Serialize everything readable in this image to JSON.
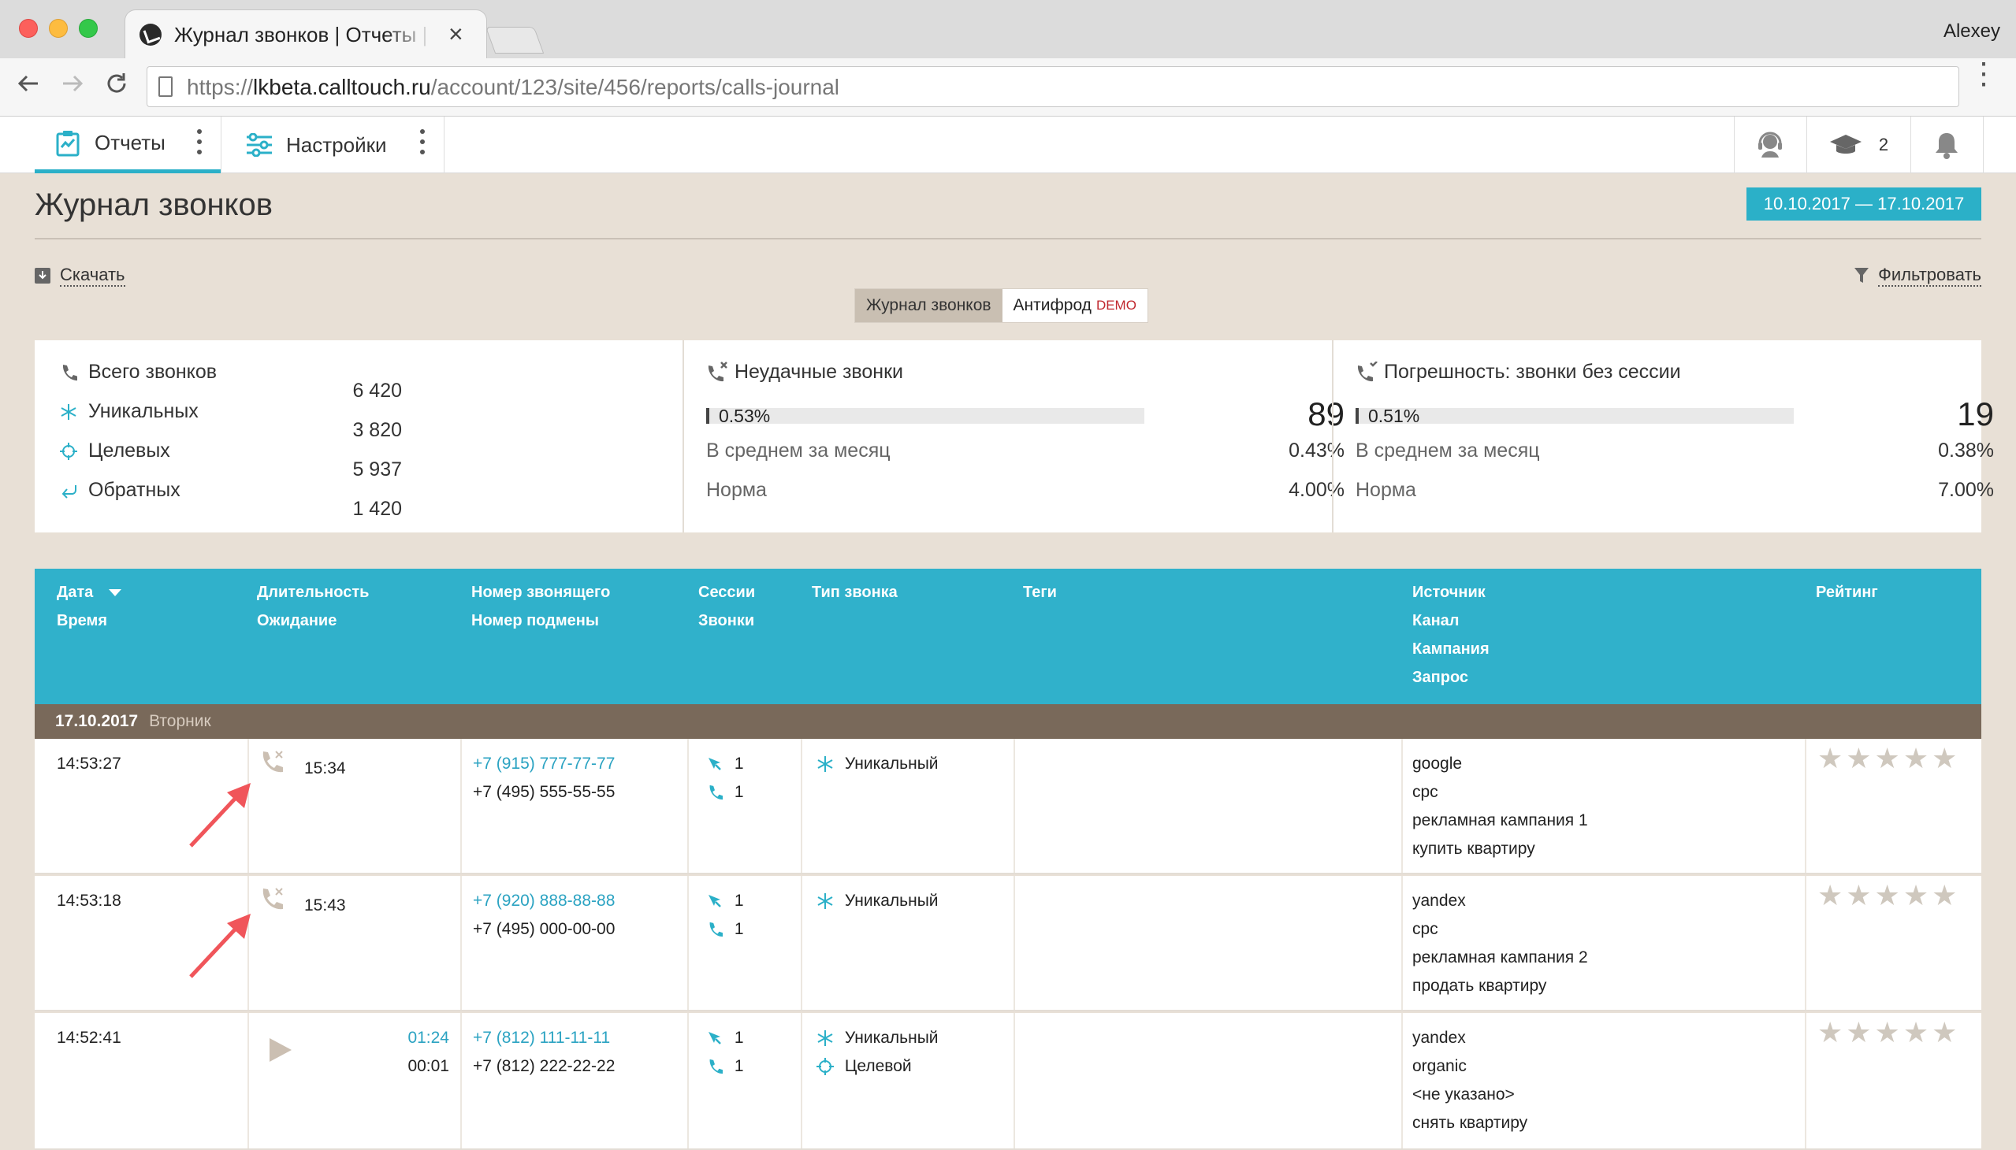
{
  "browser": {
    "tab_title": "Журнал звонков | Отчеты | Calltouch",
    "profile_name": "Alexey",
    "url_prefix": "https://",
    "url_host": "lkbeta.calltouch.ru",
    "url_path": "/account/123/site/456/reports/calls-journal"
  },
  "appnav": {
    "tabs": [
      {
        "label": "Отчеты",
        "active": true
      },
      {
        "label": "Настройки",
        "active": false
      }
    ],
    "education_count": "2"
  },
  "page": {
    "title": "Журнал звонков",
    "date_range": "10.10.2017  —  17.10.2017",
    "download_label": "Скачать",
    "filter_label": "Фильтровать",
    "segments": {
      "journal": "Журнал звонков",
      "antifraud": "Антифрод",
      "demo_badge": "DEMO"
    }
  },
  "summary": {
    "totals": [
      {
        "icon": "phone-icon",
        "label": "Всего звонков",
        "value": "6 420"
      },
      {
        "icon": "unique-icon",
        "label": "Уникальных",
        "value": "3 820"
      },
      {
        "icon": "target-icon",
        "label": "Целевых",
        "value": "5 937"
      },
      {
        "icon": "callback-icon",
        "label": "Обратных",
        "value": "1 420"
      }
    ],
    "failed": {
      "title": "Неудачные звонки",
      "percent": "0.53%",
      "fraction": 0.0053,
      "count": "89",
      "avg_label": "В среднем за месяц",
      "avg_value": "0.43%",
      "norm_label": "Норма",
      "norm_value": "4.00%"
    },
    "no_session": {
      "title": "Погрешность: звонки без сессии",
      "percent": "0.51%",
      "fraction": 0.0051,
      "count": "19",
      "avg_label": "В среднем за месяц",
      "avg_value": "0.38%",
      "norm_label": "Норма",
      "norm_value": "7.00%"
    }
  },
  "table": {
    "headers": {
      "date": "Дата",
      "time": "Время",
      "duration": "Длительность",
      "wait": "Ожидание",
      "caller": "Номер звонящего",
      "replace": "Номер подмены",
      "sessions": "Сессии",
      "calls": "Звонки",
      "type": "Тип звонка",
      "tags": "Теги",
      "source": "Источник",
      "channel": "Канал",
      "campaign": "Кампания",
      "query": "Запрос",
      "rating": "Рейтинг"
    },
    "day": {
      "date": "17.10.2017",
      "weekday": "Вторник"
    },
    "rows": [
      {
        "time": "14:53:27",
        "status": "missed",
        "duration": "15:34",
        "wait": "",
        "caller": "+7 (915) 777-77-77",
        "replace": "+7 (495) 555-55-55",
        "sessions": "1",
        "calls": "1",
        "types": [
          "Уникальный"
        ],
        "source": "google",
        "channel": "cpc",
        "campaign": "рекламная кампания 1",
        "query": "купить квартиру",
        "rating": 0
      },
      {
        "time": "14:53:18",
        "status": "missed",
        "duration": "15:43",
        "wait": "",
        "caller": "+7 (920) 888-88-88",
        "replace": "+7 (495) 000-00-00",
        "sessions": "1",
        "calls": "1",
        "types": [
          "Уникальный"
        ],
        "source": "yandex",
        "channel": "cpc",
        "campaign": "рекламная кампания 2",
        "query": "продать квартиру",
        "rating": 0
      },
      {
        "time": "14:52:41",
        "status": "answered",
        "duration": "01:24",
        "wait": "00:01",
        "caller": "+7 (812) 111-11-11",
        "replace": "+7 (812) 222-22-22",
        "sessions": "1",
        "calls": "1",
        "types": [
          "Уникальный",
          "Целевой"
        ],
        "source": "yandex",
        "channel": "organic",
        "campaign": "<не указано>",
        "query": "снять квартиру",
        "rating": 0
      }
    ]
  },
  "colors": {
    "accent": "#30b1cb",
    "link": "#2ba3c2",
    "day_row": "#79695a",
    "annotation_arrow": "#f0555a"
  }
}
